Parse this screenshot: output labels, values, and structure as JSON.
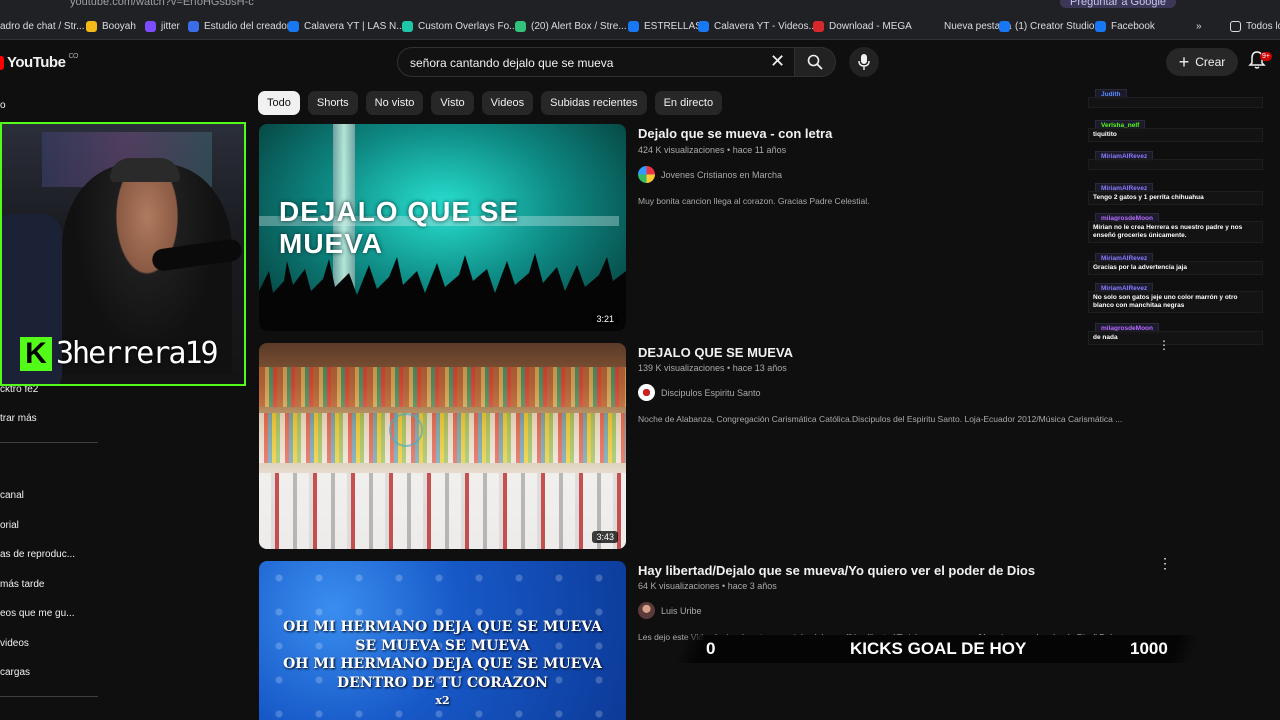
{
  "browser": {
    "url": "youtube.com/watch?v=ErfoHGsbsH-c",
    "ask_google": "Preguntar a Google",
    "bookmarks": [
      {
        "label": "adro de chat / Str...",
        "color": "#5b5fd6"
      },
      {
        "label": "Booyah",
        "color": "#f6b91a"
      },
      {
        "label": "jitter",
        "color": "#7b4dff"
      },
      {
        "label": "Estudio del creador",
        "color": "#3b6ee6"
      },
      {
        "label": "Calavera YT | LAS N...",
        "color": "#1877f2"
      },
      {
        "label": "Custom Overlays Fo...",
        "color": "#1ec7a8"
      },
      {
        "label": "(20) Alert Box / Stre...",
        "color": "#31c27c"
      },
      {
        "label": "ESTRELLAS",
        "color": "#1877f2"
      },
      {
        "label": "Calavera YT - Videos...",
        "color": "#1877f2"
      },
      {
        "label": "Download - MEGA",
        "color": "#d9272e"
      },
      {
        "label": "Nueva pestaña",
        "color": "#202124"
      },
      {
        "label": "(1) Creator Studio",
        "color": "#1877f2"
      },
      {
        "label": "Facebook",
        "color": "#1877f2"
      }
    ],
    "more": "»",
    "all_bookmarks": "Todos los"
  },
  "header": {
    "logo": "YouTube",
    "country": "CO",
    "search_query": "señora cantando dejalo que se mueva",
    "create_label": "Crear",
    "notif_count": "9+"
  },
  "chips": [
    "Todo",
    "Shorts",
    "No visto",
    "Visto",
    "Videos",
    "Subidas recientes",
    "En directo"
  ],
  "sidebar": {
    "top_item": "o",
    "item_after_cam": "cktro fe2",
    "show_more": "trar más",
    "items": [
      "canal",
      "orial",
      "as de reproduc...",
      "más tarde",
      "eos que me gu...",
      "videos",
      "cargas"
    ]
  },
  "webcam": {
    "badge": "K",
    "name": "3herrera19"
  },
  "videos": [
    {
      "title": "Dejalo que se mueva - con letra",
      "meta": "424 K visualizaciones • hace 11 años",
      "channel": "Jovenes Cristianos en Marcha",
      "description": "Muy bonita cancion llega al corazon. Gracias Padre Celestial.",
      "duration": "3:21",
      "thumb_text": "DEJALO QUE SE MUEVA"
    },
    {
      "title": "DEJALO QUE SE MUEVA",
      "meta": "139 K visualizaciones • hace 13 años",
      "channel": "Discipulos Espiritu Santo",
      "description": "Noche de Alabanza, Congregación Carismática Católica.Discipulos del Espiritu Santo. Loja-Ecuador 2012/Música Carismática ...",
      "duration": "3:43"
    },
    {
      "title": "Hay libertad/Dejalo que se mueva/Yo quiero ver el poder de Dios",
      "meta": "64 K visualizaciones • hace 3 años",
      "channel": "Luis Uribe",
      "description": "Les dejo este Video Lyrics de este popurri de alabanza \"Hay libertad/Dejalo que se mueva/Yo quiero ver el poder de Dios\" Del",
      "thumb_lines": [
        "OH MI HERMANO DEJA QUE SE MUEVA",
        "SE MUEVA SE MUEVA",
        "OH MI HERMANO DEJA QUE SE MUEVA",
        "DENTRO DE TU CORAZON",
        "x2"
      ]
    }
  ],
  "chat": [
    {
      "name": "Judith",
      "name_color": "#5b8cff",
      "text": ""
    },
    {
      "name": "Verlsha_nelf",
      "name_color": "#53fc18",
      "text": "tiquitito"
    },
    {
      "name": "MiriamAlRevez",
      "name_color": "#8a7bff",
      "text": ""
    },
    {
      "name": "MiriamAlRevez",
      "name_color": "#8a7bff",
      "text": "Tengo 2 gatos y 1 perrita chihuahua"
    },
    {
      "name": "milagrosdeMoon",
      "name_color": "#b86bff",
      "text": "Mirian no le crea Herrera es nuestro padre y nos enseñó groceries únicamente."
    },
    {
      "name": "MiriamAlRevez",
      "name_color": "#8a7bff",
      "text": "Gracias por la advertencia jaja"
    },
    {
      "name": "MiriamAlRevez",
      "name_color": "#8a7bff",
      "text": "No solo son gatos jeje uno color marrón y otro blanco con manchitaa negras"
    },
    {
      "name": "milagrosdeMoon",
      "name_color": "#b86bff",
      "text": "de nada"
    }
  ],
  "goal": {
    "current": "0",
    "label": "KICKS GOAL DE HOY",
    "target": "1000"
  }
}
